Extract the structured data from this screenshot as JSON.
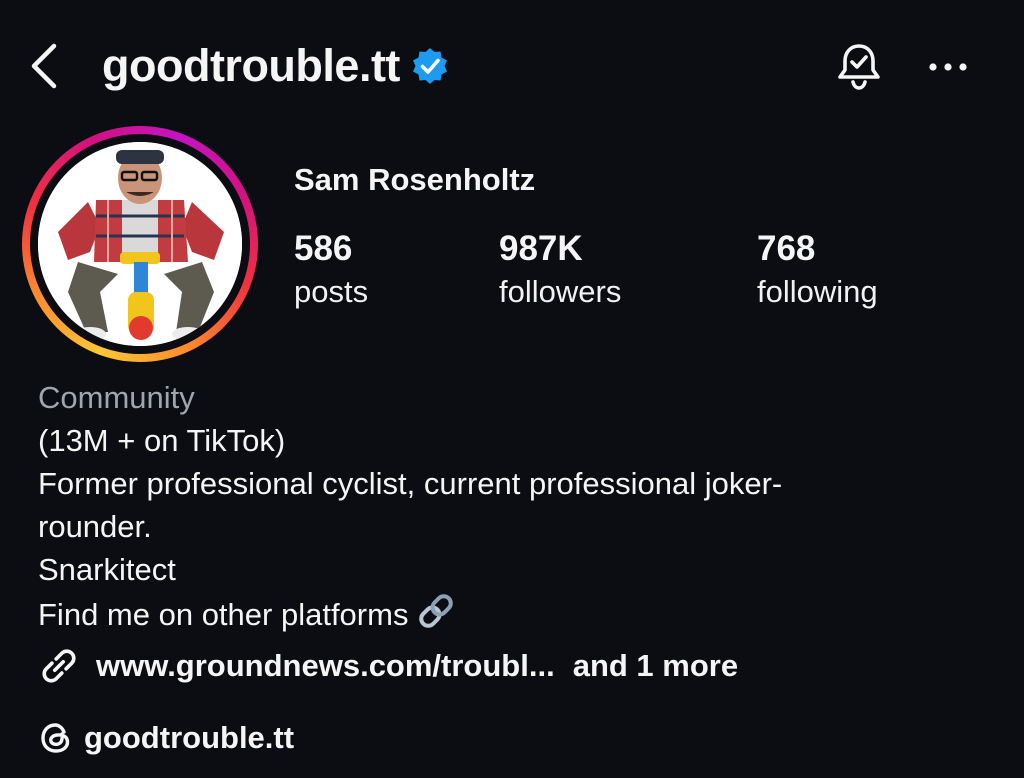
{
  "header": {
    "username": "goodtrouble.tt",
    "verified": true,
    "icons": {
      "back": "back-chevron-icon",
      "verified": "verified-badge-icon",
      "notifications": "notification-bell-icon",
      "more": "more-options-icon"
    }
  },
  "profile": {
    "full_name": "Sam Rosenholtz",
    "avatar": "profile-photo",
    "story_ring": true
  },
  "stats": [
    {
      "value": "586",
      "label": "posts"
    },
    {
      "value": "987K",
      "label": "followers"
    },
    {
      "value": "768",
      "label": "following"
    }
  ],
  "bio": {
    "category": "Community",
    "lines": [
      "(13M + on TikTok)",
      "Former professional cyclist, current professional joker-",
      "rounder.",
      "Snarkitect",
      "Find me on other platforms"
    ],
    "trailing_icon": "link-emoji-icon"
  },
  "links": {
    "url": "www.groundnews.com/troubl...",
    "more": "and 1 more",
    "icon": "link-icon"
  },
  "threads": {
    "handle": "goodtrouble.tt",
    "icon": "threads-icon"
  },
  "colors": {
    "background": "#0c0d12",
    "text": "#f5f5f5",
    "category": "#9ea6ae",
    "verified_blue": "#1d9bf0"
  }
}
